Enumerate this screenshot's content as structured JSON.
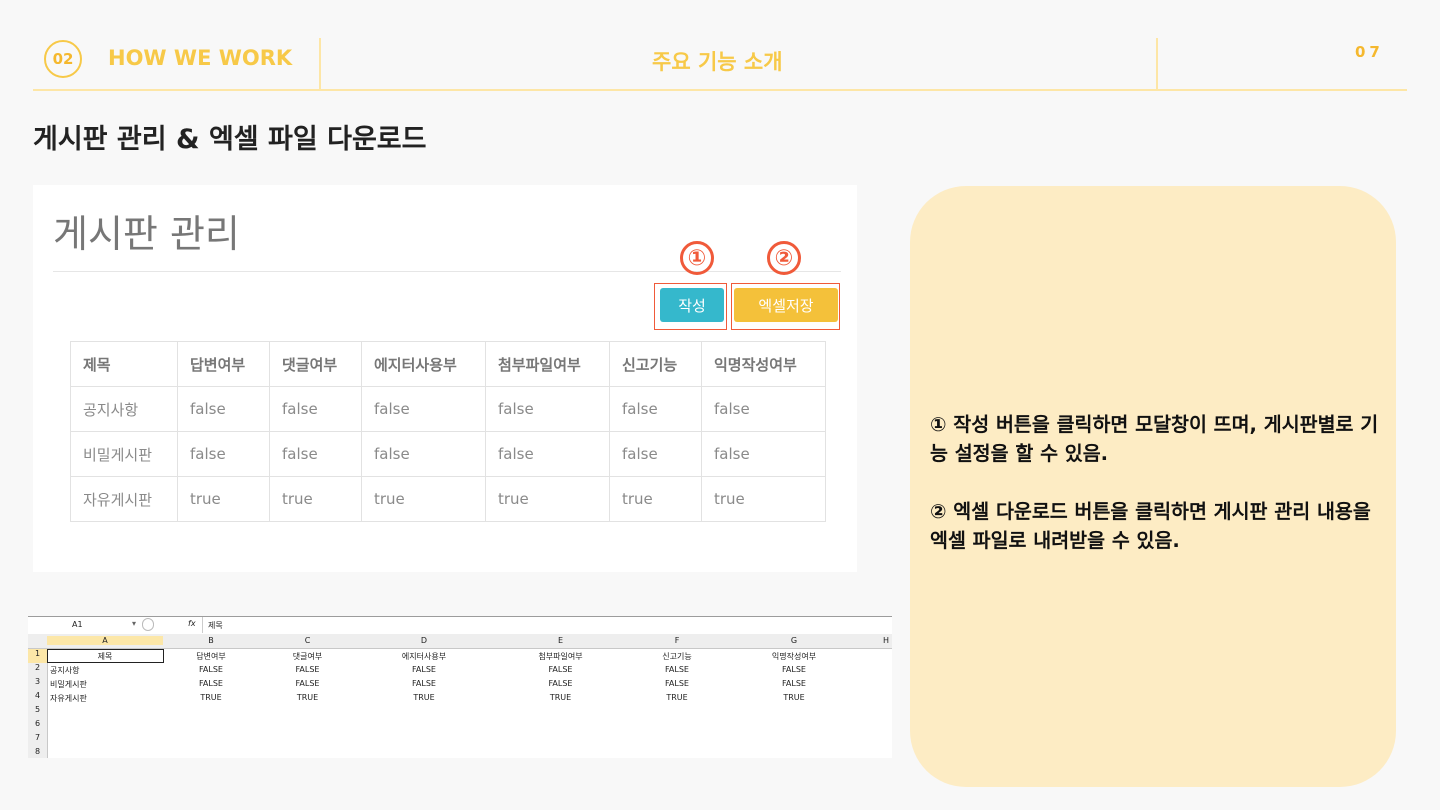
{
  "header": {
    "section_number": "02",
    "section_label": "HOW WE WORK",
    "center_title": "주요 기능 소개",
    "page_number": "07"
  },
  "section_title": "게시판 관리 & 엑셀 파일 다운로드",
  "panel": {
    "title": "게시판 관리",
    "marker_1": "①",
    "marker_2": "②",
    "write_button": "작성",
    "excel_button": "엑셀저장",
    "columns": [
      "제목",
      "답변여부",
      "댓글여부",
      "에지터사용부",
      "첨부파일여부",
      "신고기능",
      "익명작성여부"
    ],
    "rows": [
      [
        "공지사항",
        "false",
        "false",
        "false",
        "false",
        "false",
        "false"
      ],
      [
        "비밀게시판",
        "false",
        "false",
        "false",
        "false",
        "false",
        "false"
      ],
      [
        "자유게시판",
        "true",
        "true",
        "true",
        "true",
        "true",
        "true"
      ]
    ]
  },
  "excel": {
    "name_box": "A1",
    "fx": "fx",
    "formula": "제목",
    "col_letters": [
      "A",
      "B",
      "C",
      "D",
      "E",
      "F",
      "G",
      "H"
    ],
    "row_numbers": [
      "1",
      "2",
      "3",
      "4",
      "5",
      "6",
      "7",
      "8"
    ],
    "header_row": [
      "제목",
      "답변여부",
      "댓글여부",
      "에지터사용부",
      "첨부파일여부",
      "신고기능",
      "익명작성여부"
    ],
    "rows": [
      [
        "공지사항",
        "FALSE",
        "FALSE",
        "FALSE",
        "FALSE",
        "FALSE",
        "FALSE"
      ],
      [
        "비밀게시판",
        "FALSE",
        "FALSE",
        "FALSE",
        "FALSE",
        "FALSE",
        "FALSE"
      ],
      [
        "자유게시판",
        "TRUE",
        "TRUE",
        "TRUE",
        "TRUE",
        "TRUE",
        "TRUE"
      ]
    ]
  },
  "callout": {
    "item_1": "① 작성 버튼을 클릭하면 모달창이 뜨며, 게시판별로 기능 설정을 할 수 있음.",
    "item_2": "② 엑셀 다운로드 버튼을 클릭하면 게시판 관리 내용을 엑셀 파일로 내려받을 수 있음."
  },
  "colors": {
    "accent_yellow": "#f7c948",
    "marker_red": "#f05a3a",
    "write_button": "#35b8cc",
    "excel_button": "#f4c13a",
    "callout_bg": "#fdecc4"
  }
}
